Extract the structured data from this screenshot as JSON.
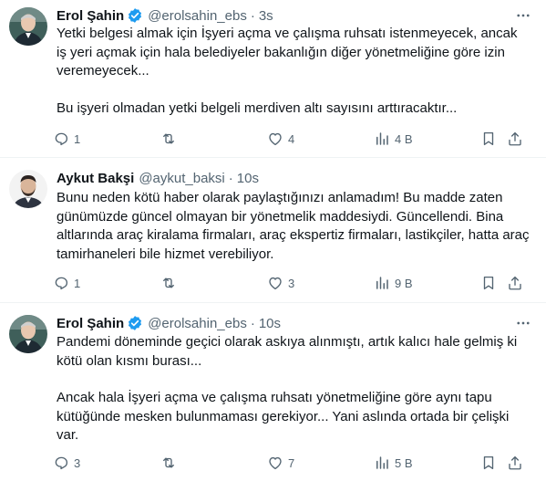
{
  "tweets": [
    {
      "name": "Erol Şahin",
      "verified": true,
      "handle": "@erolsahin_ebs",
      "time": "3s",
      "paragraphs": [
        "Yetki belgesi almak için İşyeri açma ve çalışma ruhsatı istenmeyecek, ancak iş yeri açmak için hala belediyeler bakanlığın diğer yönetmeliğine göre izin veremeyecek...",
        "Bu işyeri olmadan yetki belgeli merdiven altı sayısını arttıracaktır..."
      ],
      "replies": "1",
      "retweets": "",
      "likes": "4",
      "views": "4 B"
    },
    {
      "name": "Aykut Bakşi",
      "verified": false,
      "handle": "@aykut_baksi",
      "time": "10s",
      "paragraphs": [
        "Bunu neden kötü haber olarak paylaştığınızı anlamadım! Bu madde zaten günümüzde güncel olmayan bir yönetmelik maddesiydi. Güncellendi. Bina altlarında araç kiralama firmaları, araç ekspertiz firmaları, lastikçiler, hatta araç tamirhaneleri bile hizmet verebiliyor."
      ],
      "replies": "1",
      "retweets": "",
      "likes": "3",
      "views": "9 B"
    },
    {
      "name": "Erol Şahin",
      "verified": true,
      "handle": "@erolsahin_ebs",
      "time": "10s",
      "paragraphs": [
        "Pandemi döneminde geçici olarak askıya alınmıştı, artık kalıcı hale gelmiş ki kötü olan kısmı burası...",
        "Ancak hala İşyeri açma ve çalışma ruhsatı yönetmeliğine göre aynı tapu kütüğünde mesken bulunmaması gerekiyor... Yani aslında ortada bir çelişki var."
      ],
      "replies": "3",
      "retweets": "",
      "likes": "7",
      "views": "5 B"
    }
  ],
  "colors": {
    "text": "#0f1419",
    "secondary": "#536471",
    "verified": "#1d9bf0",
    "divider": "#eff3f4"
  },
  "icons": {
    "reply": "reply-icon",
    "retweet": "retweet-icon",
    "like": "like-icon",
    "views": "views-icon",
    "bookmark": "bookmark-icon",
    "share": "share-icon",
    "more": "more-icon",
    "verified": "verified-badge-icon"
  }
}
